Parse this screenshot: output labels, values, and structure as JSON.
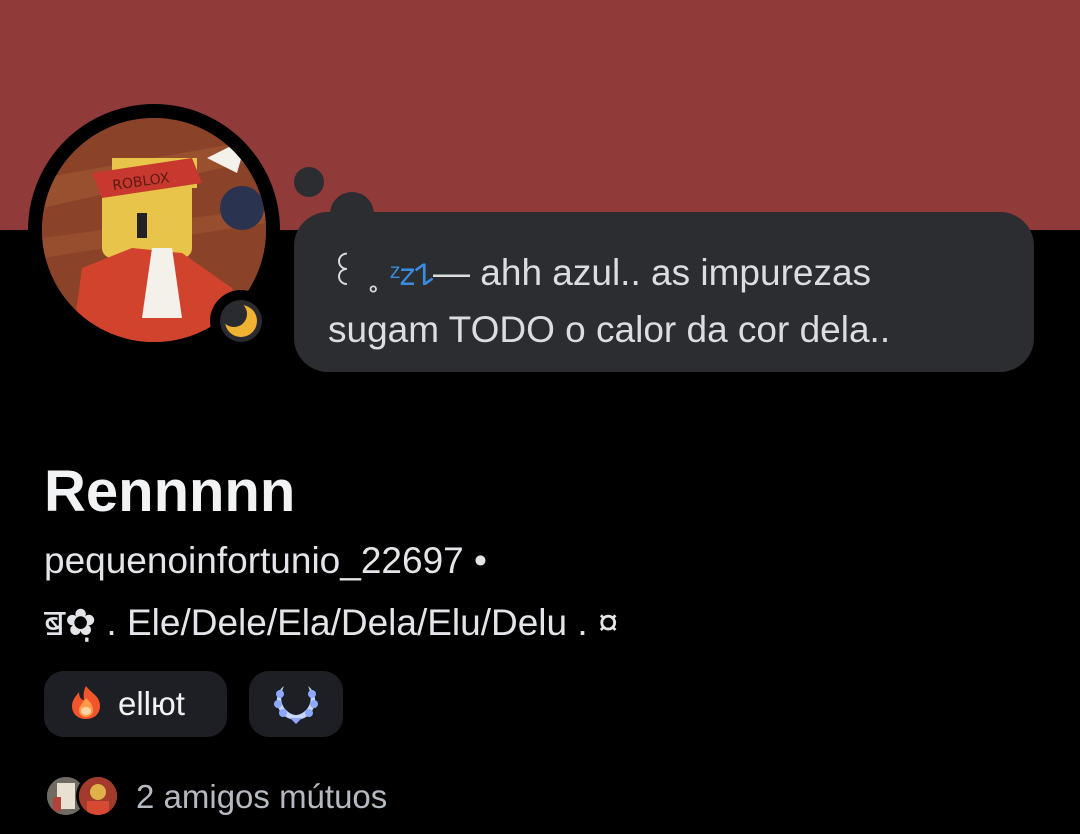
{
  "profile": {
    "display_name": "Rennnnn",
    "username_line": "pequenoinfortunio_22697 •",
    "pronouns_line": "ॿ✿̣  .  Ele/Dele/Ela/Dela/Elu/Delu  .  ¤",
    "avatar_text": "ROBLOX",
    "status": "idle",
    "status_note": {
      "line1_prefix": "꒰ ˳ ",
      "line1_zz": "ᶻ𝗓𐰁",
      "line1_rest": "— ahh azul.. as impurezas",
      "line2": "sugam TODO o calor da cor dela.."
    }
  },
  "tags": [
    {
      "icon": "flame-icon",
      "label": "ellюt"
    },
    {
      "icon": "laurel-badge-icon",
      "label": ""
    }
  ],
  "mutual_friends": {
    "text": "2 amigos mútuos"
  },
  "colors": {
    "banner": "#903a3a",
    "background": "#000000",
    "bubble": "#2b2d31",
    "idle": "#f0b232"
  }
}
